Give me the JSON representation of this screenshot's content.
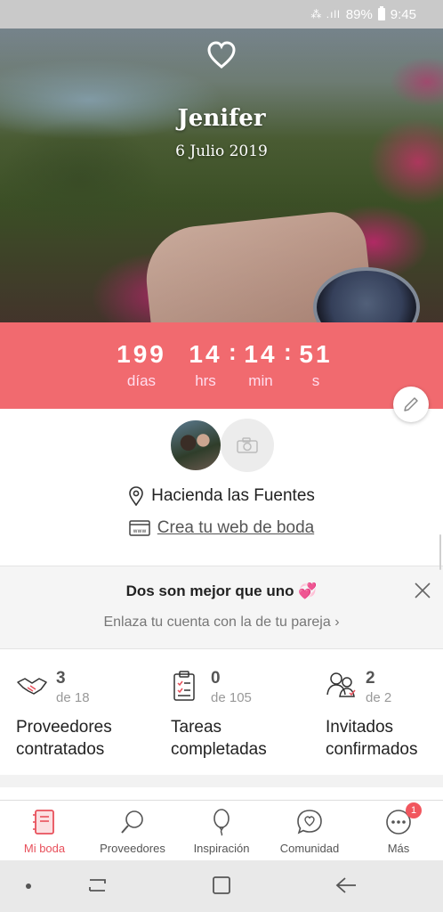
{
  "status_bar": {
    "battery": "89%",
    "time": "9:45"
  },
  "hero": {
    "name": "Jenifer",
    "date": "6 Julio 2019"
  },
  "countdown": {
    "days": "199",
    "days_label": "días",
    "hours": "14",
    "hours_label": "hrs",
    "minutes": "14",
    "minutes_label": "min",
    "seconds": "51",
    "seconds_label": "s"
  },
  "profile": {
    "venue": "Hacienda las Fuentes",
    "web_link": "Crea tu web de boda"
  },
  "partner_card": {
    "title": "Dos son mejor que uno 💞",
    "subtitle": "Enlaza tu cuenta con la de tu pareja  ›"
  },
  "stats": [
    {
      "count": "3",
      "total": "de 18",
      "label_line1": "Proveedores",
      "label_line2": "contratados",
      "icon": "handshake-icon"
    },
    {
      "count": "0",
      "total": "de 105",
      "label_line1": "Tareas",
      "label_line2": "completadas",
      "icon": "checklist-icon"
    },
    {
      "count": "2",
      "total": "de 2",
      "label_line1": "Invitados",
      "label_line2": "confirmados",
      "icon": "guests-icon"
    }
  ],
  "bottom_nav": [
    {
      "label": "Mi boda",
      "icon": "notebook-icon",
      "active": true
    },
    {
      "label": "Proveedores",
      "icon": "search-icon"
    },
    {
      "label": "Inspiración",
      "icon": "balloon-icon"
    },
    {
      "label": "Comunidad",
      "icon": "chat-heart-icon"
    },
    {
      "label": "Más",
      "icon": "more-icon",
      "badge": "1"
    }
  ],
  "colors": {
    "accent": "#f16a6f",
    "active_nav": "#e8505b"
  }
}
